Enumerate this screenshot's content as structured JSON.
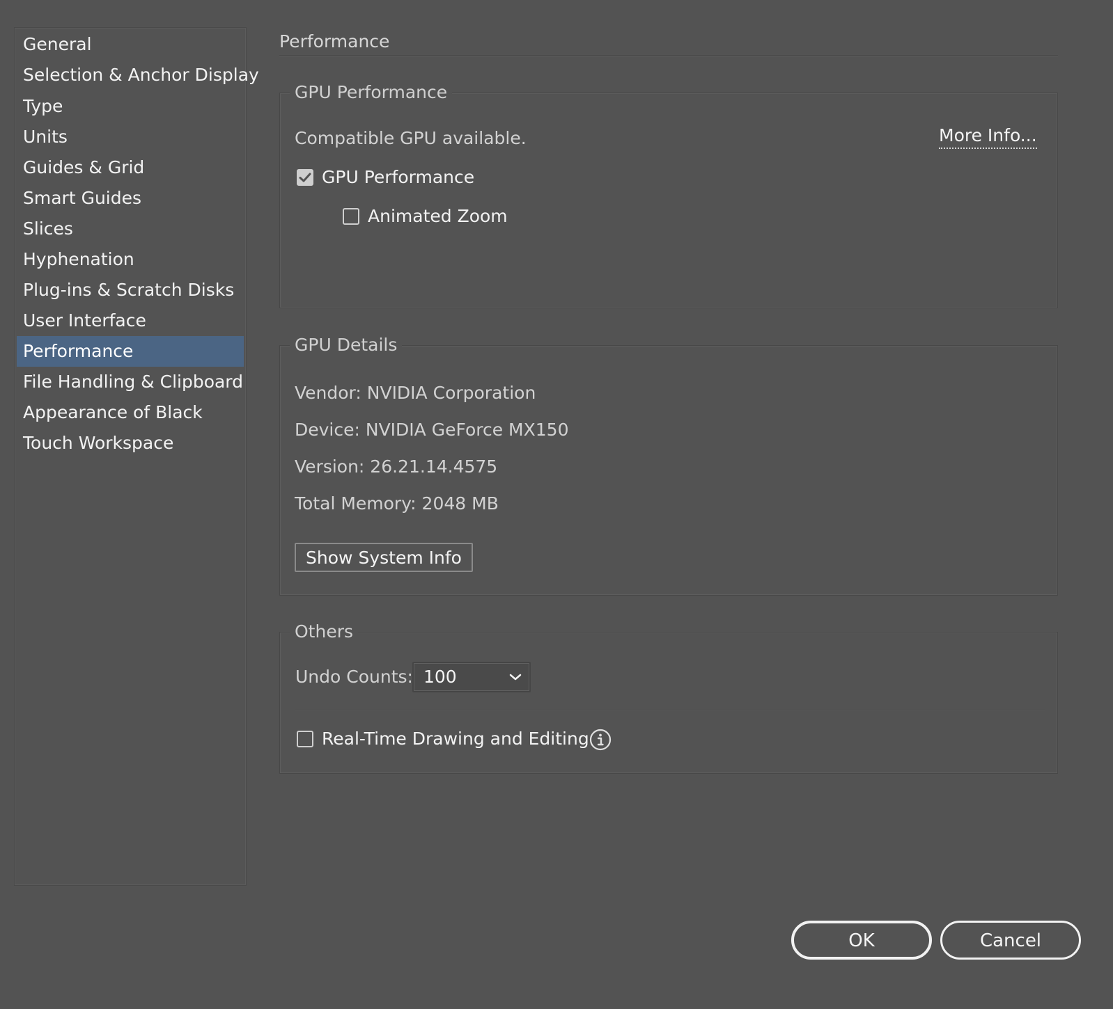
{
  "sidebar": {
    "items": [
      {
        "label": "General"
      },
      {
        "label": "Selection & Anchor Display"
      },
      {
        "label": "Type"
      },
      {
        "label": "Units"
      },
      {
        "label": "Guides & Grid"
      },
      {
        "label": "Smart Guides"
      },
      {
        "label": "Slices"
      },
      {
        "label": "Hyphenation"
      },
      {
        "label": "Plug-ins & Scratch Disks"
      },
      {
        "label": "User Interface"
      },
      {
        "label": "Performance"
      },
      {
        "label": "File Handling & Clipboard"
      },
      {
        "label": "Appearance of Black"
      },
      {
        "label": "Touch Workspace"
      }
    ],
    "selected": "Performance",
    "selected_color": "#4b6584"
  },
  "page": {
    "title": "Performance"
  },
  "gpu_performance": {
    "legend": "GPU Performance",
    "status": "Compatible GPU available.",
    "more_info": "More Info...",
    "gpu_checkbox": {
      "label": "GPU Performance",
      "checked": true
    },
    "zoom_checkbox": {
      "label": "Animated Zoom",
      "checked": false
    }
  },
  "gpu_details": {
    "legend": "GPU Details",
    "vendor": "Vendor: NVIDIA Corporation",
    "device": "Device: NVIDIA GeForce MX150",
    "version": "Version: 26.21.14.4575",
    "memory": "Total Memory: 2048 MB",
    "system_info_button": "Show System Info"
  },
  "others": {
    "legend": "Others",
    "undo_label": "Undo Counts:",
    "undo_value": "100",
    "realtime_checkbox": {
      "label": "Real-Time Drawing and Editing",
      "checked": false
    },
    "info_icon": "info-icon"
  },
  "footer": {
    "ok_label": "OK",
    "cancel_label": "Cancel"
  },
  "icons": {
    "checkmark": "checkmark-icon",
    "dropdown": "chevron-down-icon",
    "info": "info-icon"
  }
}
